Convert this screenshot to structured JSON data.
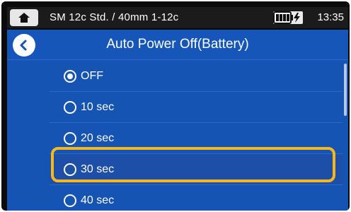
{
  "status_bar": {
    "title": "SM 12c Std. / 40mm 1-12c",
    "time": "13:35",
    "home_icon": "home-icon",
    "battery_icon": "battery-charging-icon"
  },
  "screen": {
    "title": "Auto Power Off(Battery)",
    "back_icon": "chevron-left-icon"
  },
  "options": [
    {
      "label": "OFF",
      "selected": true
    },
    {
      "label": "10 sec",
      "selected": false
    },
    {
      "label": "20 sec",
      "selected": false
    },
    {
      "label": "30 sec",
      "selected": false,
      "highlighted": true
    },
    {
      "label": "40 sec",
      "selected": false
    }
  ],
  "colors": {
    "screen_bg": "#1554b2",
    "highlight_frame": "#f5b81c"
  }
}
